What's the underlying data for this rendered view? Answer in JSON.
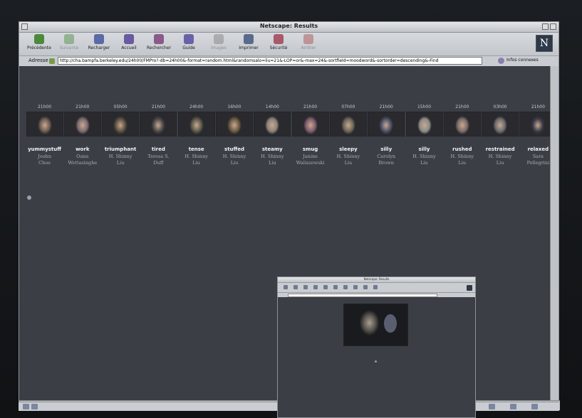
{
  "window": {
    "title": "Netscape: Results"
  },
  "toolbar": {
    "buttons": [
      {
        "label": "Précédente",
        "color": "#4a8a3a",
        "disabled": false
      },
      {
        "label": "Suivante",
        "color": "#4a8a3a",
        "disabled": true
      },
      {
        "label": "Recharger",
        "color": "#5a6aa8",
        "disabled": false
      },
      {
        "label": "Accueil",
        "color": "#6a5aa0",
        "disabled": false
      },
      {
        "label": "Rechercher",
        "color": "#8a5a8a",
        "disabled": false
      },
      {
        "label": "Guide",
        "color": "#6a62a8",
        "disabled": false
      },
      {
        "label": "Images",
        "color": "#7a7a7a",
        "disabled": true
      },
      {
        "label": "Imprimer",
        "color": "#5a6a8a",
        "disabled": false
      },
      {
        "label": "Sécurité",
        "color": "#a85a6a",
        "disabled": false
      },
      {
        "label": "Arrêter",
        "color": "#a84a4a",
        "disabled": true
      }
    ],
    "logo": "N"
  },
  "location": {
    "label": "Adresse",
    "url": "http://cha.bampfa.berkeley.edu/24h00/FMPro?-db=24h00&-format=random.html&randomsalo=liu=21&-LOP=or&-max=24&-sortfield=moodword&-sortorder=descending&-Find",
    "info": "Infos connexes"
  },
  "entries": [
    {
      "time": "21h00",
      "mood": "yummystuff",
      "author": [
        "Joohn",
        "Choe"
      ],
      "photo": "#6a5a50"
    },
    {
      "time": "21h00",
      "mood": "work",
      "author": [
        "Oana",
        "Wettasinghe"
      ],
      "photo": "#7a6a70"
    },
    {
      "time": "05h00",
      "mood": "triumphant",
      "author": [
        "H. Shinny",
        "Liu"
      ],
      "photo": "#5a4e40"
    },
    {
      "time": "21h00",
      "mood": "tired",
      "author": [
        "Teresa S.",
        "Duff"
      ],
      "photo": "#4a4848"
    },
    {
      "time": "24h00",
      "mood": "tense",
      "author": [
        "H. Shinny",
        "Liu"
      ],
      "photo": "#5a5848"
    },
    {
      "time": "16h00",
      "mood": "stuffed",
      "author": [
        "H. Shinny",
        "Liu"
      ],
      "photo": "#6a5840"
    },
    {
      "time": "14h00",
      "mood": "steamy",
      "author": [
        "H. Shinny",
        "Liu"
      ],
      "photo": "#8a8078"
    },
    {
      "time": "21h00",
      "mood": "smug",
      "author": [
        "Janine",
        "Waliszewski"
      ],
      "photo": "#7a5a6a"
    },
    {
      "time": "07h00",
      "mood": "sleepy",
      "author": [
        "H. Shinny",
        "Liu"
      ],
      "photo": "#6a6458"
    },
    {
      "time": "21h00",
      "mood": "silly",
      "author": [
        "Carolyn",
        "Brown"
      ],
      "photo": "#4a5068"
    },
    {
      "time": "15h00",
      "mood": "silly",
      "author": [
        "H. Shinny",
        "Liu"
      ],
      "photo": "#8a8a88"
    },
    {
      "time": "21h00",
      "mood": "rushed",
      "author": [
        "H. Shinny",
        "Liu"
      ],
      "photo": "#7a6a66"
    },
    {
      "time": "03h00",
      "mood": "restrained",
      "author": [
        "H. Shinny",
        "Liu"
      ],
      "photo": "#6a6a6e"
    },
    {
      "time": "21h00",
      "mood": "relaxed",
      "author": [
        "Sara",
        "Pellegrini"
      ],
      "photo": "#3a3a48"
    }
  ],
  "popup": {
    "title": "Netscape: Results"
  }
}
